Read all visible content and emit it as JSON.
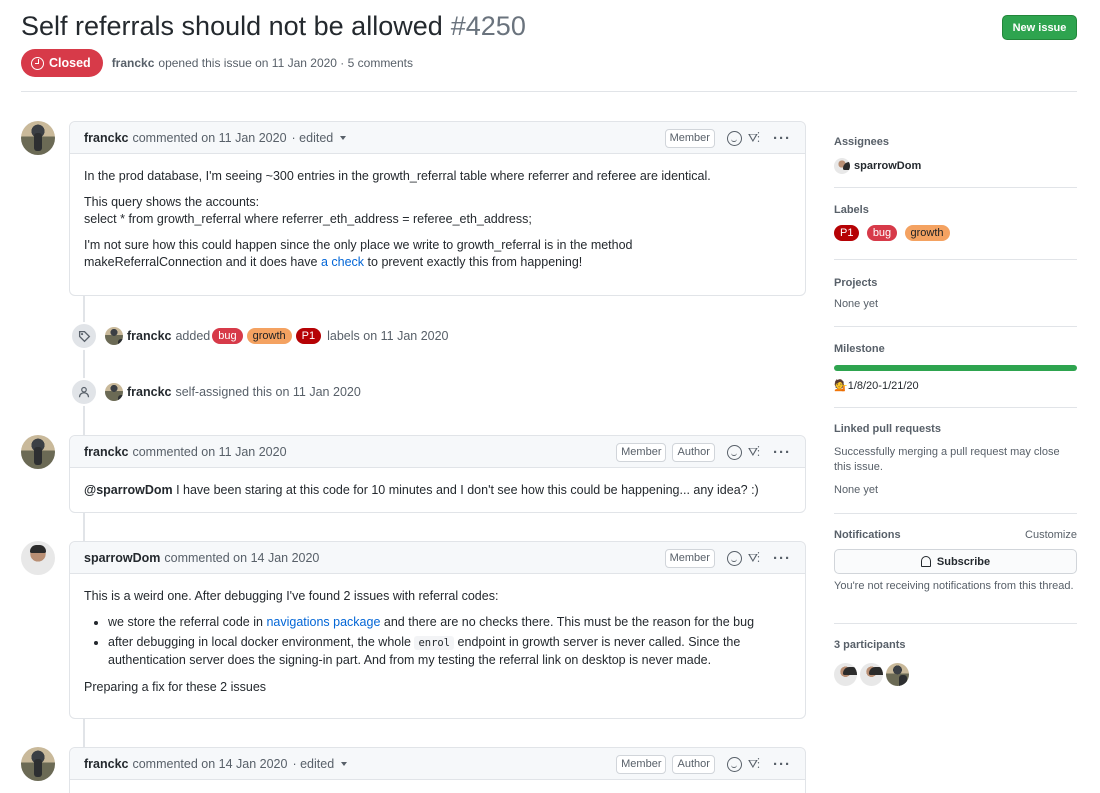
{
  "issue": {
    "title": "Self referrals should not be allowed",
    "number": "#4250",
    "status": "Closed",
    "author": "franckc",
    "meta_text": "opened this issue on 11 Jan 2020 · 5 comments",
    "new_issue_label": "New issue"
  },
  "comments": [
    {
      "author": "franckc",
      "date_text": "commented on 11 Jan 2020",
      "edited": "· edited",
      "roles": [
        "Member"
      ],
      "paragraphs": [
        "In the prod database, I'm seeing ~300 entries in the growth_referral table where referrer and referee are identical.",
        "This query shows the accounts:",
        "select * from growth_referral where referrer_eth_address = referee_eth_address;",
        "I'm not sure how this could happen since the only place we write to growth_referral is in the method",
        "makeReferralConnection and it does have",
        "a check",
        "to prevent exactly this from happening!"
      ]
    },
    {
      "author": "franckc",
      "date_text": "commented on 11 Jan 2020",
      "roles": [
        "Member",
        "Author"
      ],
      "mention": "@sparrowDom",
      "text": "I have been staring at this code for 10 minutes and I don't see how this could be happening... any idea? :)"
    },
    {
      "author": "sparrowDom",
      "date_text": "commented on 14 Jan 2020",
      "roles": [
        "Member"
      ],
      "intro": "This is a weird one. After debugging I've found 2 issues with referral codes:",
      "bullet1_a": "we store the referral code in",
      "bullet1_link": "navigations package",
      "bullet1_b": "and there are no checks there. This must be the reason for the bug",
      "bullet2_a": "after debugging in local docker environment, the whole",
      "bullet2_code": "enrol",
      "bullet2_b": "endpoint in growth server is never called. Since the authentication server does the signing-in part. And from my testing the referral link on desktop is never made.",
      "outro": "Preparing a fix for these 2 issues"
    },
    {
      "author": "franckc",
      "date_text": "commented on 14 Jan 2020",
      "edited": "· edited",
      "roles": [
        "Member",
        "Author"
      ]
    }
  ],
  "events": {
    "labels_event": {
      "actor": "franckc",
      "verb": "added",
      "labels": [
        "bug",
        "growth",
        "P1"
      ],
      "tail": "labels on 11 Jan 2020"
    },
    "assign_event": {
      "actor": "franckc",
      "text": "self-assigned this on 11 Jan 2020"
    }
  },
  "sidebar": {
    "assignees_title": "Assignees",
    "assignee": "sparrowDom",
    "labels_title": "Labels",
    "labels": [
      "P1",
      "bug",
      "growth"
    ],
    "projects_title": "Projects",
    "projects_value": "None yet",
    "milestone_title": "Milestone",
    "milestone_progress": 1.0,
    "milestone_value": "1/8/20-1/21/20",
    "milestone_emoji": "💁",
    "linked_title": "Linked pull requests",
    "linked_desc": "Successfully merging a pull request may close this issue.",
    "linked_value": "None yet",
    "notifications_title": "Notifications",
    "customize_label": "Customize",
    "subscribe_label": "Subscribe",
    "notif_desc": "You're not receiving notifications from this thread.",
    "participants_title": "3 participants"
  },
  "colors": {
    "closed": "#d73a49",
    "green": "#2ea44f",
    "link": "#0366d6"
  }
}
